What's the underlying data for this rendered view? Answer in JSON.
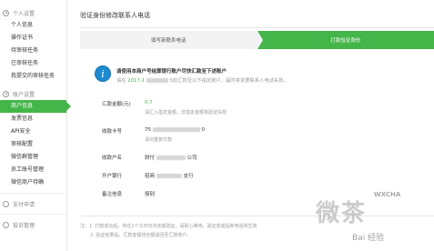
{
  "sidebar": {
    "sections": [
      {
        "title": "个人设置",
        "icon": "user-icon",
        "items": [
          "个人信息",
          "操作证书",
          "待审核任务",
          "已审核任务",
          "我提交的审核任务"
        ]
      },
      {
        "title": "账户设置",
        "icon": "gear-icon",
        "items": [
          "商户信息",
          "发票信息",
          "API安全",
          "审核配置",
          "微信群管理",
          "员工账号管理",
          "微信商户待确"
        ]
      }
    ],
    "active_item": "商户信息",
    "bottom_items": [
      "支付申请",
      "投诉管理"
    ]
  },
  "page": {
    "title": "验证身份修改联系人电话",
    "steps": [
      "填写新联系电话",
      "打款验证身份"
    ],
    "current_step": 2
  },
  "tip": {
    "badge": "i",
    "title": "请使用本商户号结算银行账户尽快汇款至下述账户",
    "text_prefix": "请在",
    "date": "2017-1",
    "text_suffix": "5前汇款至以下指定账户，届时将变更联系人电话失败。"
  },
  "form": {
    "amount_label": "汇款金额(元)",
    "amount_value": "0.7",
    "amount_hint": "请汇入指定金额，非指定金额将验证失败",
    "card_label": "收款卡号",
    "card_value_prefix": "75",
    "card_value_suffix": "0",
    "card_hint": "请勿重复打款",
    "payee_label": "收款户名",
    "payee_prefix": "财付",
    "payee_suffix": "公司",
    "bank_label": "开户银行",
    "bank_prefix": "招商",
    "bank_suffix": "支行",
    "remark_label": "备注信息",
    "remark_value": "授别"
  },
  "notes": [
    "注：1. 打款成功后，将在1个工作日内完成验证，请耐心等待，验证完成后新电话将生效",
    "2. 验证结果后，汇款金额将全额退回至汇款账户。"
  ],
  "watermark": {
    "big": "微茶",
    "small": "WXCHA",
    "baidu": "Bai 经验"
  },
  "colors": {
    "accent": "#44b549",
    "badge": "#1d8bd0"
  }
}
